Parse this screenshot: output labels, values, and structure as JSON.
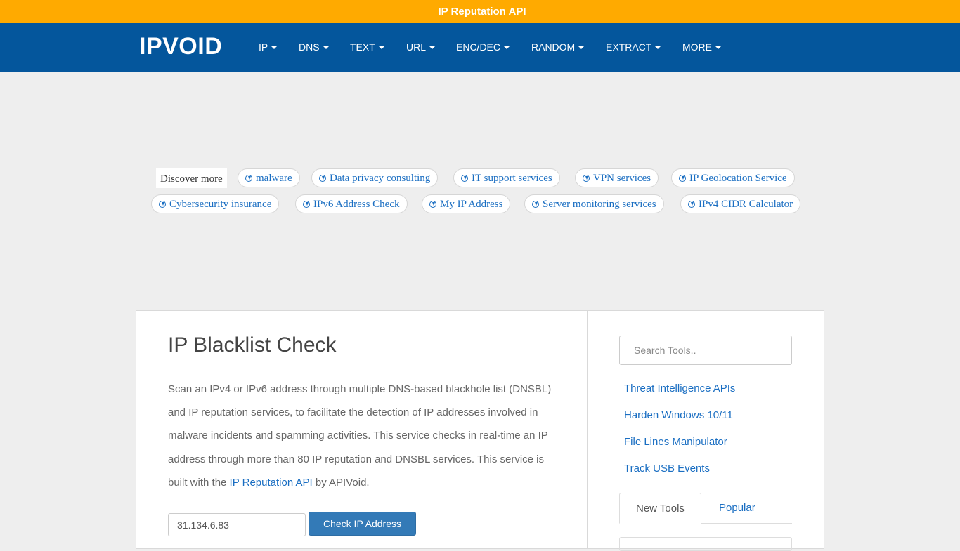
{
  "banner": {
    "icon": "megaphone-icon",
    "glyph": "",
    "text": "IP Reputation API"
  },
  "nav": {
    "logo": "IPVOID",
    "items": [
      {
        "label": "IP"
      },
      {
        "label": "DNS"
      },
      {
        "label": "TEXT"
      },
      {
        "label": "URL"
      },
      {
        "label": "ENC/DEC"
      },
      {
        "label": "RANDOM"
      },
      {
        "label": "EXTRACT"
      },
      {
        "label": "MORE"
      }
    ],
    "icons": [
      {
        "name": "nav-icon-1",
        "glyph": ""
      },
      {
        "name": "nav-icon-2",
        "glyph": ""
      }
    ]
  },
  "discover": {
    "label": "Discover more",
    "pills": [
      "malware",
      "Data privacy consulting",
      "IT support services",
      "VPN services",
      "IP Geolocation Service",
      "Cybersecurity insurance",
      "IPv6 Address Check",
      "My IP Address",
      "Server monitoring services",
      "IPv4 CIDR Calculator"
    ]
  },
  "main": {
    "title": "IP Blacklist Check",
    "description_before_link": "Scan an IPv4 or IPv6 address through multiple DNS-based blackhole list (DNSBL) and IP reputation services, to facilitate the detection of IP addresses involved in malware incidents and spamming activities. This service checks in real-time an IP address through more than 80 IP reputation and DNSBL services. This service is built with the ",
    "description_link": "IP Reputation API",
    "description_after_link": " by APIVoid.",
    "ip_value": "31.134.6.83",
    "check_button": "Check IP Address"
  },
  "sidebar": {
    "search_placeholder": "Search Tools..",
    "links": [
      {
        "glyph": "",
        "label": "Threat Intelligence APIs"
      },
      {
        "glyph": "",
        "label": "Harden Windows 10/11"
      },
      {
        "glyph": "",
        "label": "File Lines Manipulator"
      },
      {
        "glyph": "",
        "label": "Track USB Events"
      }
    ],
    "tabs": [
      {
        "glyph": "",
        "label": "New Tools"
      },
      {
        "glyph": "",
        "label": "Popular"
      }
    ]
  }
}
